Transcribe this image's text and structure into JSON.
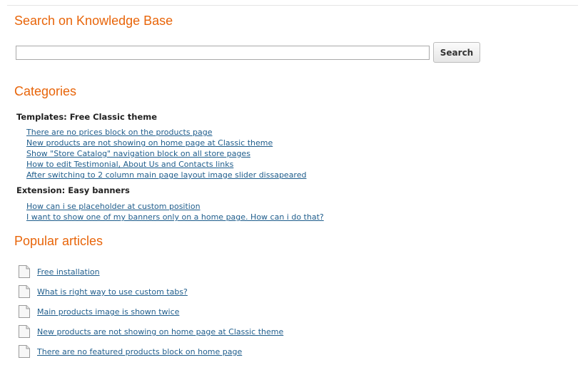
{
  "search": {
    "heading": "Search on Knowledge Base",
    "input_value": "",
    "button_label": "Search"
  },
  "categories": {
    "heading": "Categories",
    "groups": [
      {
        "title": "Templates: Free Classic theme",
        "links": [
          "There are no prices block on the products page",
          "New products are not showing on home page at Classic theme",
          "Show \"Store Catalog\" navigation block on all store pages",
          "How to edit Testimonial, About Us and Contacts links",
          "After switching to 2 column main page layout image slider dissapeared"
        ]
      },
      {
        "title": "Extension: Easy banners",
        "links": [
          "How can i se placeholder at custom position",
          "I want to show one of my banners only on a home page. How can i do that?"
        ]
      }
    ]
  },
  "popular": {
    "heading": "Popular articles",
    "icon": "document-icon",
    "articles": [
      "Free installation",
      "What is right way to use custom tabs?",
      "Main products image is shown twice",
      "New products are not showing on home page at Classic theme",
      "There are no featured products block on home page"
    ]
  },
  "colors": {
    "heading": "#e8650a",
    "link": "#1f5d8c"
  }
}
